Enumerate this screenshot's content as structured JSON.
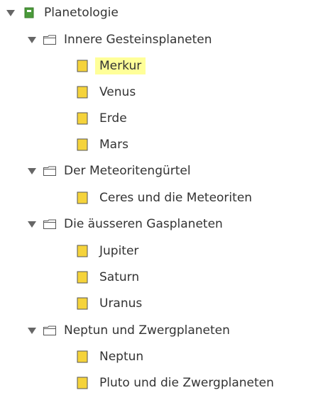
{
  "tree": {
    "root": {
      "label": "Planetologie",
      "icon": "book-green-icon",
      "expanded": true
    },
    "folders": [
      {
        "label": "Innere Gesteinsplaneten",
        "icon": "folder-icon",
        "expanded": true,
        "pages": [
          {
            "label": "Merkur",
            "selected": true
          },
          {
            "label": "Venus",
            "selected": false
          },
          {
            "label": "Erde",
            "selected": false
          },
          {
            "label": "Mars",
            "selected": false
          }
        ]
      },
      {
        "label": "Der Meteoritengürtel",
        "icon": "folder-icon",
        "expanded": true,
        "pages": [
          {
            "label": "Ceres und die Meteoriten",
            "selected": false
          }
        ]
      },
      {
        "label": "Die äusseren Gasplaneten",
        "icon": "folder-icon",
        "expanded": true,
        "pages": [
          {
            "label": "Jupiter",
            "selected": false
          },
          {
            "label": "Saturn",
            "selected": false
          },
          {
            "label": "Uranus",
            "selected": false
          }
        ]
      },
      {
        "label": "Neptun und Zwergplaneten",
        "icon": "folder-icon",
        "expanded": true,
        "pages": [
          {
            "label": "Neptun",
            "selected": false
          },
          {
            "label": "Pluto und die Zwergplaneten",
            "selected": false
          }
        ]
      }
    ]
  },
  "colors": {
    "selection_highlight": "#ffff99",
    "page_icon_fill": "#f5d33b",
    "page_icon_border": "#555555",
    "root_icon": "#4a9a3a",
    "twisty": "#666666",
    "folder_stroke": "#555555"
  }
}
